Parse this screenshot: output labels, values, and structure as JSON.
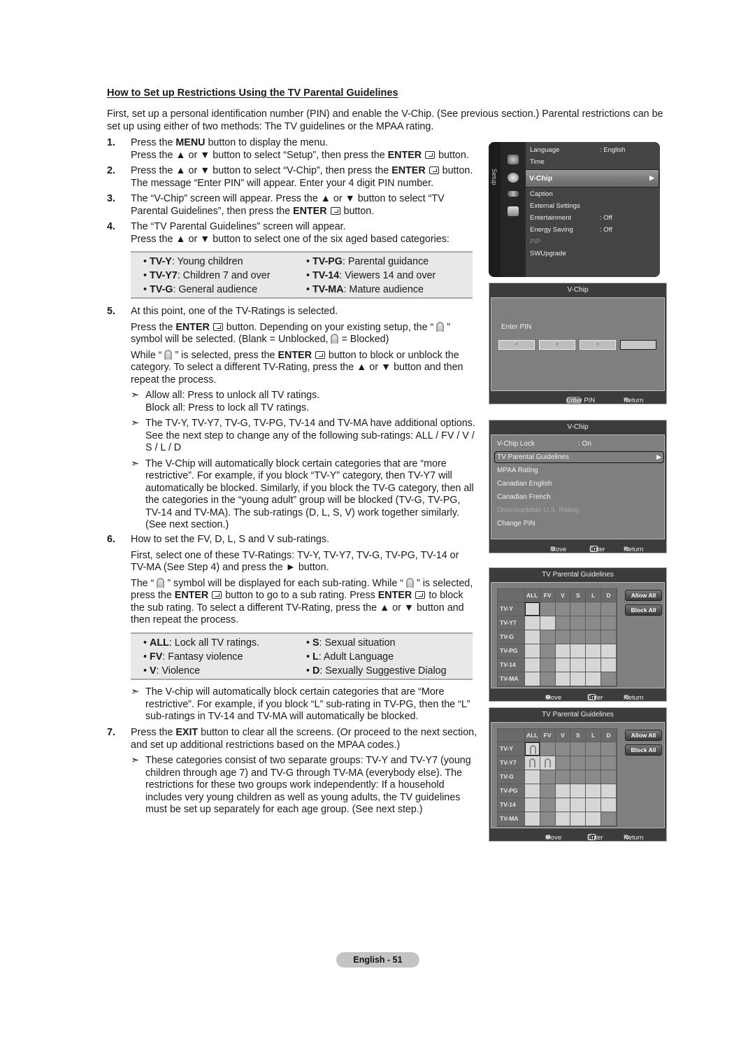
{
  "title": "How to Set up Restrictions Using the TV Parental Guidelines",
  "intro": "First, set up a personal identification number (PIN) and enable the V-Chip. (See previous section.) Parental restrictions can be set up using either of two methods: The TV guidelines or the MPAA rating.",
  "steps": {
    "s1": {
      "num": "1.",
      "a1": "Press the ",
      "a2": "MENU",
      "a3": " button to display the menu.",
      "b1": "Press the ▲ or ▼ button to select “Setup”, then press the ",
      "b2": "ENTER",
      "b3": " button."
    },
    "s2": {
      "num": "2.",
      "a1": "Press the ▲ or ▼ button to select “V-Chip”, then press the ",
      "a2": "ENTER",
      "a3": "button. The message “Enter PIN” will appear. Enter your 4 digit PIN number."
    },
    "s3": {
      "num": "3.",
      "a1": "The “V-Chip” screen will appear. Press the ▲ or ▼ button to select “TV Parental Guidelines”, then press the ",
      "a2": "ENTER",
      "a3": " button."
    },
    "s4": {
      "num": "4.",
      "a1": "The “TV Parental Guidelines” screen will appear.",
      "a2": "Press the ▲ or ▼ button to select one of the six aged based categories:"
    },
    "s5": {
      "num": "5.",
      "a1": "At this point, one of the TV-Ratings is selected.",
      "b1": "Press the ",
      "b2": "ENTER",
      "b3": " button. Depending on your existing setup, the “ ",
      "b4": " ” symbol will be selected. (Blank = Unblocked, ",
      "b5": " = Blocked)",
      "c1": "While “ ",
      "c2": " ” is selected, press the ",
      "c3": "ENTER",
      "c4": " button to block or unblock the category. To select a different TV-Rating, press the ▲ or ▼ button and then repeat the process.",
      "notes": [
        "Allow all: Press to unlock all TV ratings.\nBlock all: Press to lock all TV ratings.",
        "The TV-Y, TV-Y7, TV-G, TV-PG, TV-14 and TV-MA have additional options. See the next step to change any of the following sub-ratings: ALL / FV / V / S / L / D",
        "The V-Chip will automatically block certain categories that are “more restrictive”. For example, if you block “TV-Y” category, then TV-Y7 will automatically be blocked. Similarly, if you block the TV-G category, then all the categories in the “young adult” group will be blocked (TV-G, TV-PG, TV-14 and TV-MA). The sub-ratings (D, L, S, V) work together similarly. (See next section.)"
      ]
    },
    "s6": {
      "num": "6.",
      "a1": "How to set the FV, D, L, S and V sub-ratings.",
      "b1": "First, select one of these TV-Ratings: TV-Y, TV-Y7, TV-G, TV-PG, TV-14 or TV-MA (See Step 4) and press the ► button.",
      "c1": "The “ ",
      "c2": " ” symbol will be displayed for each sub-rating. While “ ",
      "c3": " ” is selected, press the ",
      "c4": "ENTER",
      "c5": " button to go to a sub rating. Press ",
      "c6": "ENTER",
      "c7": " to block the sub rating. To select a different TV-Rating, press the ▲ or ▼ button and then repeat the process.",
      "note": "The V-chip will automatically block certain categories that are “More restrictive”. For example, if you block “L” sub-rating in TV-PG, then the “L” sub-ratings in TV-14 and TV-MA will automatically be blocked."
    },
    "s7": {
      "num": "7.",
      "a1": "Press the ",
      "a2": "EXIT",
      "a3": " button to clear all the screens. (Or proceed to the next section, and set up additional restrictions based on the MPAA codes.)",
      "note": "These categories consist of two separate groups: TV-Y and TV-Y7 (young children through age 7) and TV-G through TV-MA (everybody else). The restrictions for these two groups work independently: If a household includes very young children as well as young adults, the TV guidelines must be set up separately for each age group. (See next step.)"
    }
  },
  "note_arrow": "➣",
  "ratings_box": [
    {
      "code": "TV-Y",
      "desc": ": Young children"
    },
    {
      "code": "TV-Y7",
      "desc": ": Children 7 and over"
    },
    {
      "code": "TV-G",
      "desc": ": General audience"
    },
    {
      "code": "TV-PG",
      "desc": ": Parental guidance"
    },
    {
      "code": "TV-14",
      "desc": ": Viewers 14 and over"
    },
    {
      "code": "TV-MA",
      "desc": ": Mature audience"
    }
  ],
  "subratings_box": [
    {
      "code": "ALL",
      "desc": ": Lock all TV ratings."
    },
    {
      "code": "FV",
      "desc": ": Fantasy violence"
    },
    {
      "code": "V",
      "desc": ": Violence"
    },
    {
      "code": "S",
      "desc": ": Sexual situation"
    },
    {
      "code": "L",
      "desc": ": Adult Language"
    },
    {
      "code": "D",
      "desc": ": Sexually Suggestive Dialog"
    }
  ],
  "bullet": "•",
  "setup_menu": {
    "rail_label": "Setup",
    "items": [
      {
        "label": "Language",
        "value": ": English"
      },
      {
        "label": "Time",
        "value": ""
      },
      {
        "label": "V-Chip",
        "value": "",
        "selected": true
      },
      {
        "label": "Caption",
        "value": ""
      },
      {
        "label": "External Settings",
        "value": ""
      },
      {
        "label": "Entertainment",
        "value": ": Off"
      },
      {
        "label": "Energy Saving",
        "value": ": Off"
      },
      {
        "label": "PIP",
        "value": "",
        "disabled": true
      },
      {
        "label": "SWUpgrade",
        "value": ""
      }
    ],
    "arrow": "▶"
  },
  "pin_dialog": {
    "title": "V-Chip",
    "label": "Enter PIN",
    "digits": [
      "*",
      "*",
      "*",
      ""
    ],
    "footer": {
      "badge": "0~9",
      "enter": "Enter PIN",
      "return": "Return"
    }
  },
  "vchip_dialog": {
    "title": "V-Chip",
    "items": [
      {
        "label": "V-Chip Lock",
        "value": ": On"
      },
      {
        "label": "TV Parental Guidelines",
        "value": "",
        "highlighted": true
      },
      {
        "label": "MPAA Rating",
        "value": ""
      },
      {
        "label": "Canadian English",
        "value": ""
      },
      {
        "label": "Canadian French",
        "value": ""
      },
      {
        "label": "Downloadable U.S. Rating",
        "value": "",
        "disabled": true
      },
      {
        "label": "Change PIN",
        "value": ""
      }
    ],
    "footer": {
      "move": "Move",
      "enter": "Enter",
      "return": "Return"
    }
  },
  "tv_guidelines": {
    "title": "TV Parental Guidelines",
    "columns": [
      "ALL",
      "FV",
      "V",
      "S",
      "L",
      "D"
    ],
    "rows": [
      "TV-Y",
      "TV-Y7",
      "TV-G",
      "TV-PG",
      "TV-14",
      "TV-MA"
    ],
    "available": [
      [
        1,
        0,
        0,
        0,
        0,
        0
      ],
      [
        1,
        1,
        0,
        0,
        0,
        0
      ],
      [
        1,
        0,
        0,
        0,
        0,
        0
      ],
      [
        1,
        0,
        1,
        1,
        1,
        1
      ],
      [
        1,
        0,
        1,
        1,
        1,
        1
      ],
      [
        1,
        0,
        1,
        1,
        1,
        0
      ]
    ],
    "allow_all": "Allow All",
    "block_all": "Block All",
    "footer": {
      "move": "Move",
      "enter": "Enter",
      "return": "Return"
    },
    "screen1_locked": [],
    "screen2_locked": [
      [
        0,
        0
      ],
      [
        1,
        0
      ],
      [
        1,
        1
      ]
    ]
  },
  "page_label": "English - 51"
}
